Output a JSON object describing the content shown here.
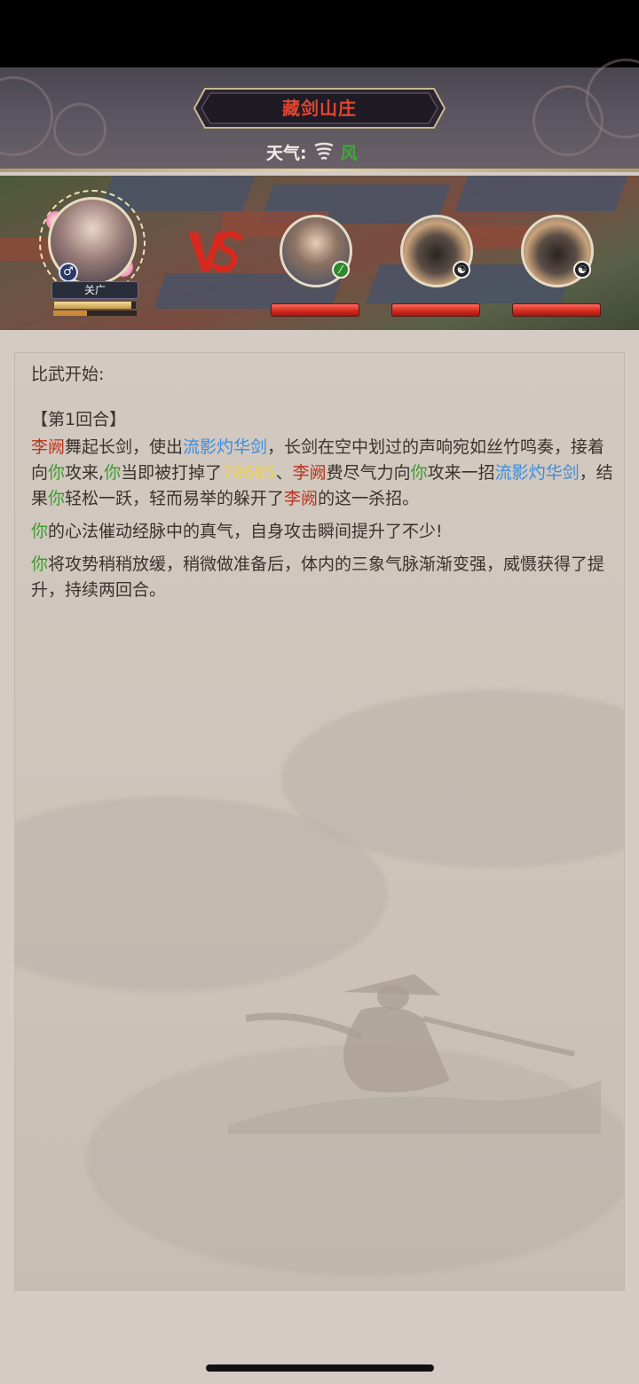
{
  "header": {
    "location_title": "藏剑山庄",
    "weather_label": "天气:",
    "weather_icon": "whirlwind-icon",
    "weather_value": "风",
    "colors": {
      "title": "#e0462f",
      "weather_value": "#3fa83a"
    }
  },
  "battle": {
    "player": {
      "name": "关广",
      "gender_icon": "male-icon",
      "hp_fraction": 0.95,
      "energy_fraction": 0.4
    },
    "vs_icon": "vs-emblem-icon",
    "enemies": [
      {
        "badge_icon": "green-sword-icon",
        "hp_fraction": 1.0
      },
      {
        "badge_icon": "yin-yang-icon",
        "hp_fraction": 1.0
      },
      {
        "badge_icon": "yin-yang-icon",
        "hp_fraction": 1.0
      }
    ]
  },
  "log": {
    "start": "比武开始:",
    "round": "【第1回合】",
    "paragraph1": {
      "s1": "李阙",
      "s2": "舞起长剑，使出",
      "s3": "流影灼华剑",
      "s4": "，长剑在空中划过的声响宛如丝竹鸣奏，接着向",
      "s5": "你",
      "s6": "攻来,",
      "s7": "你",
      "s8": "当即被打掉了",
      "s9": "78685",
      "s10": "、",
      "s11": "李阙",
      "s12": "费尽气力向",
      "s13": "你",
      "s14": "攻来一招",
      "s15": "流影灼华剑",
      "s16": "，结果",
      "s17": "你",
      "s18": "轻松一跃，轻而易举的躲开了",
      "s19": "李阙",
      "s20": "的这一杀招。"
    },
    "paragraph2": {
      "s1": "你",
      "s2": "的心法催动经脉中的真气，自身攻击瞬间提升了不少!"
    },
    "paragraph3": {
      "s1": "你",
      "s2": "将攻势稍稍放缓，稍微做准备后，体内的三象气脉渐渐变强，威慑获得了提升，持续两回合。"
    },
    "colors": {
      "name": "#b8351f",
      "skill": "#3b8de0",
      "you": "#3a9d2e",
      "damage": "#f2d24a"
    }
  }
}
